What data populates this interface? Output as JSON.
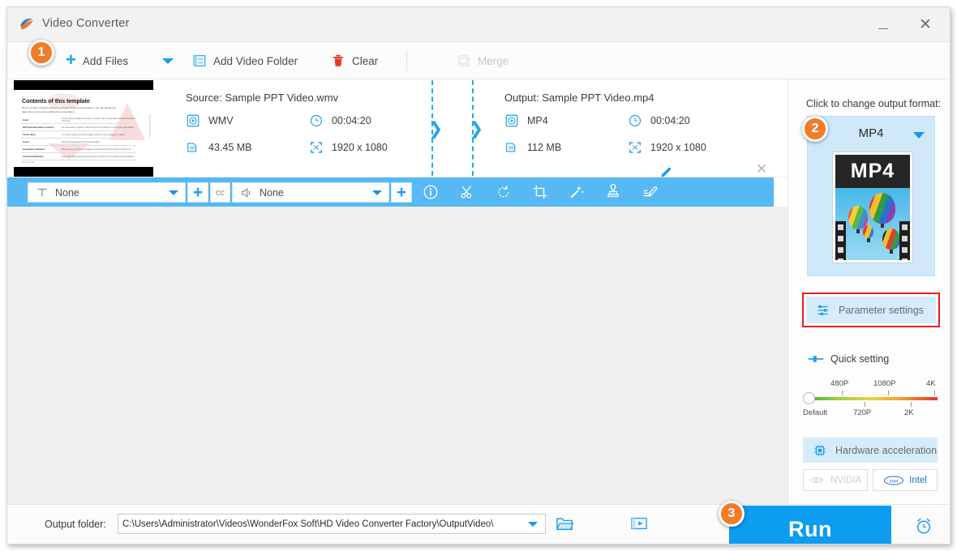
{
  "window": {
    "title": "Video Converter",
    "minimize_label": "–",
    "close_label": "✕"
  },
  "toolbar": {
    "add_files": "Add Files",
    "add_files_dropdown": "chevron-down-icon",
    "add_video_folder": "Add Video Folder",
    "clear": "Clear",
    "merge": "Merge"
  },
  "badges": {
    "one": "1",
    "two": "2",
    "three": "3"
  },
  "file_item": {
    "thumbnail": {
      "slide_title": "Contents of this template",
      "slide_sub": "Here is a slide structure based on a Thesis defense presentation. You can delete this slide when you're done editing the presentation.",
      "rows": [
        [
          "Goals",
          "To see what template currently is. Create it all, re-assemble and beautify before and open."
        ],
        [
          "Work and alternatives research",
          "An assortment of quality research items to consider for use in the presentation."
        ],
        [
          "Theme ideas",
          "You never need more than a page number to one category or grade."
        ],
        [
          "Issues",
          "All of the assessment of the presentation."
        ],
        [
          "Geographic relaxation",
          "Please see you are not managing goals and to find you will now have to fit."
        ],
        [
          "Comments/attributes",
          "Take one assortment criteria will allow for them to fit to deliver in presentations."
        ]
      ],
      "footer_left": "For more data:",
      "footer_right": "Bibliographic references",
      "sidebar_text": "Presentation by Slidesgo"
    },
    "source": {
      "title": "Source: Sample PPT Video.wmv",
      "format": "WMV",
      "duration": "00:04:20",
      "size": "43.45 MB",
      "resolution": "1920 x 1080"
    },
    "output": {
      "title": "Output: Sample PPT Video.mp4",
      "format": "MP4",
      "duration": "00:04:20",
      "size": "112 MB",
      "resolution": "1920 x 1080",
      "edit_icon": "pencil-icon",
      "close_label": "✕"
    }
  },
  "editbar": {
    "subtitle_value": "None",
    "subtitle_icon": "text-subtitle-icon",
    "audio_value": "None",
    "audio_icon": "speaker-icon",
    "add_subtitle_label": "+",
    "add_audio_label": "+",
    "cc_label": "cc",
    "tools": [
      "info-icon",
      "trim-scissors-icon",
      "rotate-icon",
      "crop-icon",
      "effects-wand-icon",
      "watermark-stamp-icon",
      "subtitle-edit-icon"
    ]
  },
  "right_panel": {
    "header": "Click to change output format:",
    "format_name": "MP4",
    "format_thumb_label": "MP4",
    "parameter_settings": "Parameter settings",
    "parameter_settings_icon": "sliders-icon",
    "highlight_color": "#ef1d1d",
    "quick_setting": "Quick setting",
    "quick_setting_icon": "slider-small-icon",
    "slider": {
      "top_labels": [
        "480P",
        "1080P",
        "4K"
      ],
      "bottom_labels": [
        "Default",
        "720P",
        "2K"
      ],
      "value": "Default"
    },
    "hardware_acceleration": "Hardware acceleration",
    "hardware_icon": "cpu-chip-icon",
    "gpu_nvidia": "NVIDIA",
    "gpu_intel": "Intel"
  },
  "bottom": {
    "output_folder_label": "Output folder:",
    "output_folder_path": "C:\\Users\\Administrator\\Videos\\WonderFox Soft\\HD Video Converter Factory\\OutputVideo\\",
    "browse_icon": "folder-open-icon",
    "preview_icon": "video-preview-icon",
    "run_label": "Run",
    "schedule_icon": "alarm-clock-icon"
  },
  "colors": {
    "accent_blue": "#0c9cf0",
    "edit_bar": "#56b9f4",
    "badge_orange": "#f07c2a",
    "panel_card": "#cfe9fb"
  }
}
